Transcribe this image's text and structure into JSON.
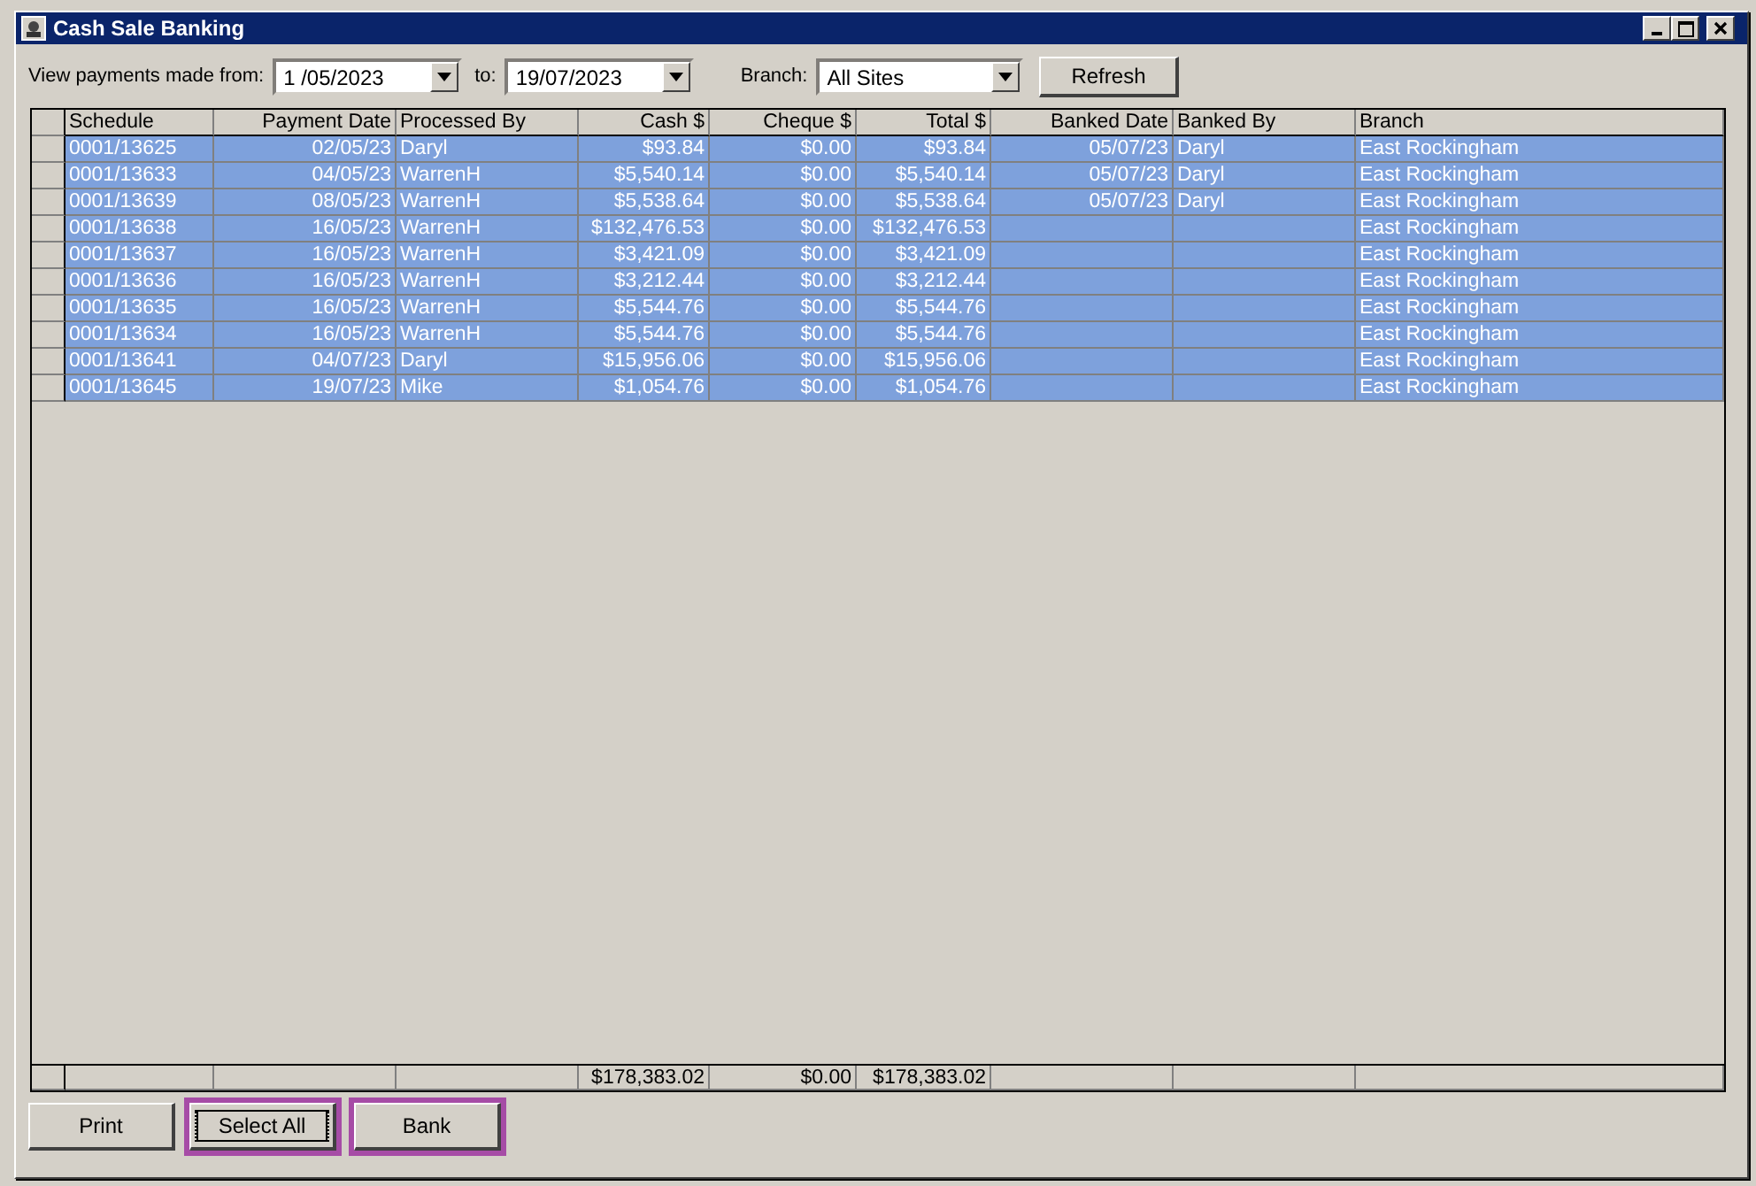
{
  "window": {
    "title": "Cash Sale Banking"
  },
  "filters": {
    "from_label": "View payments made from:",
    "from_value": "1 /05/2023",
    "to_label": "to:",
    "to_value": "19/07/2023",
    "branch_label": "Branch:",
    "branch_value": "All Sites",
    "refresh_button": "Refresh"
  },
  "table": {
    "columns": [
      "Schedule",
      "Payment Date",
      "Processed By",
      "Cash $",
      "Cheque $",
      "Total $",
      "Banked Date",
      "Banked By",
      "Branch"
    ],
    "rows": [
      {
        "selected": true,
        "cells": [
          "0001/13625",
          "02/05/23",
          "Daryl",
          "$93.84",
          "$0.00",
          "$93.84",
          "05/07/23",
          "Daryl",
          "East Rockingham"
        ]
      },
      {
        "selected": true,
        "cells": [
          "0001/13633",
          "04/05/23",
          "WarrenH",
          "$5,540.14",
          "$0.00",
          "$5,540.14",
          "05/07/23",
          "Daryl",
          "East Rockingham"
        ]
      },
      {
        "selected": true,
        "cells": [
          "0001/13639",
          "08/05/23",
          "WarrenH",
          "$5,538.64",
          "$0.00",
          "$5,538.64",
          "05/07/23",
          "Daryl",
          "East Rockingham"
        ]
      },
      {
        "selected": true,
        "cells": [
          "0001/13638",
          "16/05/23",
          "WarrenH",
          "$132,476.53",
          "$0.00",
          "$132,476.53",
          "",
          "",
          "East Rockingham"
        ]
      },
      {
        "selected": true,
        "cells": [
          "0001/13637",
          "16/05/23",
          "WarrenH",
          "$3,421.09",
          "$0.00",
          "$3,421.09",
          "",
          "",
          "East Rockingham"
        ]
      },
      {
        "selected": true,
        "cells": [
          "0001/13636",
          "16/05/23",
          "WarrenH",
          "$3,212.44",
          "$0.00",
          "$3,212.44",
          "",
          "",
          "East Rockingham"
        ]
      },
      {
        "selected": true,
        "cells": [
          "0001/13635",
          "16/05/23",
          "WarrenH",
          "$5,544.76",
          "$0.00",
          "$5,544.76",
          "",
          "",
          "East Rockingham"
        ]
      },
      {
        "selected": true,
        "cells": [
          "0001/13634",
          "16/05/23",
          "WarrenH",
          "$5,544.76",
          "$0.00",
          "$5,544.76",
          "",
          "",
          "East Rockingham"
        ]
      },
      {
        "selected": true,
        "cells": [
          "0001/13641",
          "04/07/23",
          "Daryl",
          "$15,956.06",
          "$0.00",
          "$15,956.06",
          "",
          "",
          "East Rockingham"
        ]
      },
      {
        "selected": true,
        "cells": [
          "0001/13645",
          "19/07/23",
          "Mike",
          "$1,054.76",
          "$0.00",
          "$1,054.76",
          "",
          "",
          "East Rockingham"
        ]
      }
    ],
    "totals": {
      "cash": "$178,383.02",
      "cheque": "$0.00",
      "total": "$178,383.02"
    }
  },
  "buttons": [
    {
      "label": "Print",
      "focused": false,
      "highlighted": false
    },
    {
      "label": "Select All",
      "focused": true,
      "highlighted": true
    },
    {
      "label": "Bank",
      "focused": false,
      "highlighted": true
    }
  ]
}
